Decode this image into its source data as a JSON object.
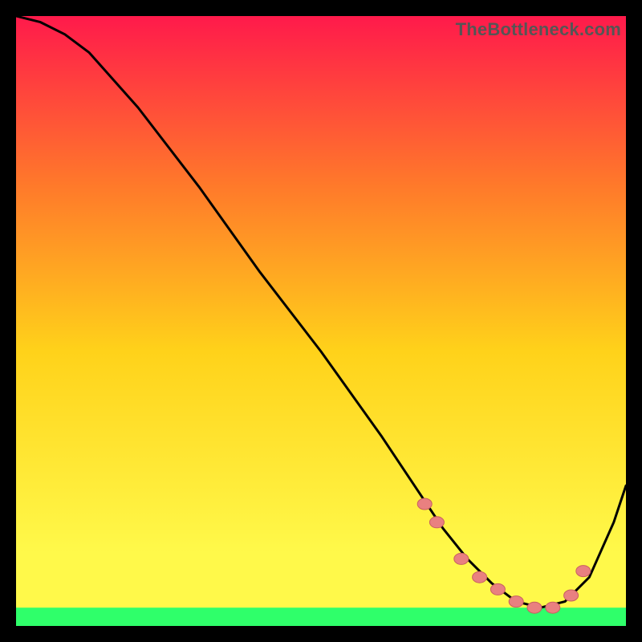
{
  "watermark": "TheBottleneck.com",
  "colors": {
    "gradient_top": "#ff1a4b",
    "gradient_mid_upper": "#ff7a2a",
    "gradient_mid": "#ffd21a",
    "gradient_lower": "#fff94a",
    "gradient_bottom_band": "#2fff6a",
    "curve": "#000000",
    "marker_fill": "#e98080",
    "marker_stroke": "#c86060"
  },
  "chart_data": {
    "type": "line",
    "title": "",
    "xlabel": "",
    "ylabel": "",
    "xlim": [
      0,
      100
    ],
    "ylim": [
      0,
      100
    ],
    "series": [
      {
        "name": "bottleneck-curve",
        "x": [
          0,
          4,
          8,
          12,
          20,
          30,
          40,
          50,
          60,
          66,
          70,
          74,
          78,
          82,
          86,
          90,
          94,
          98,
          100
        ],
        "values": [
          100,
          99,
          97,
          94,
          85,
          72,
          58,
          45,
          31,
          22,
          16,
          11,
          7,
          4,
          3,
          4,
          8,
          17,
          23
        ]
      }
    ],
    "markers": {
      "name": "highlight-points",
      "x": [
        67,
        69,
        73,
        76,
        79,
        82,
        85,
        88,
        91,
        93
      ],
      "values": [
        20,
        17,
        11,
        8,
        6,
        4,
        3,
        3,
        5,
        9
      ]
    },
    "green_band_y": 3
  }
}
